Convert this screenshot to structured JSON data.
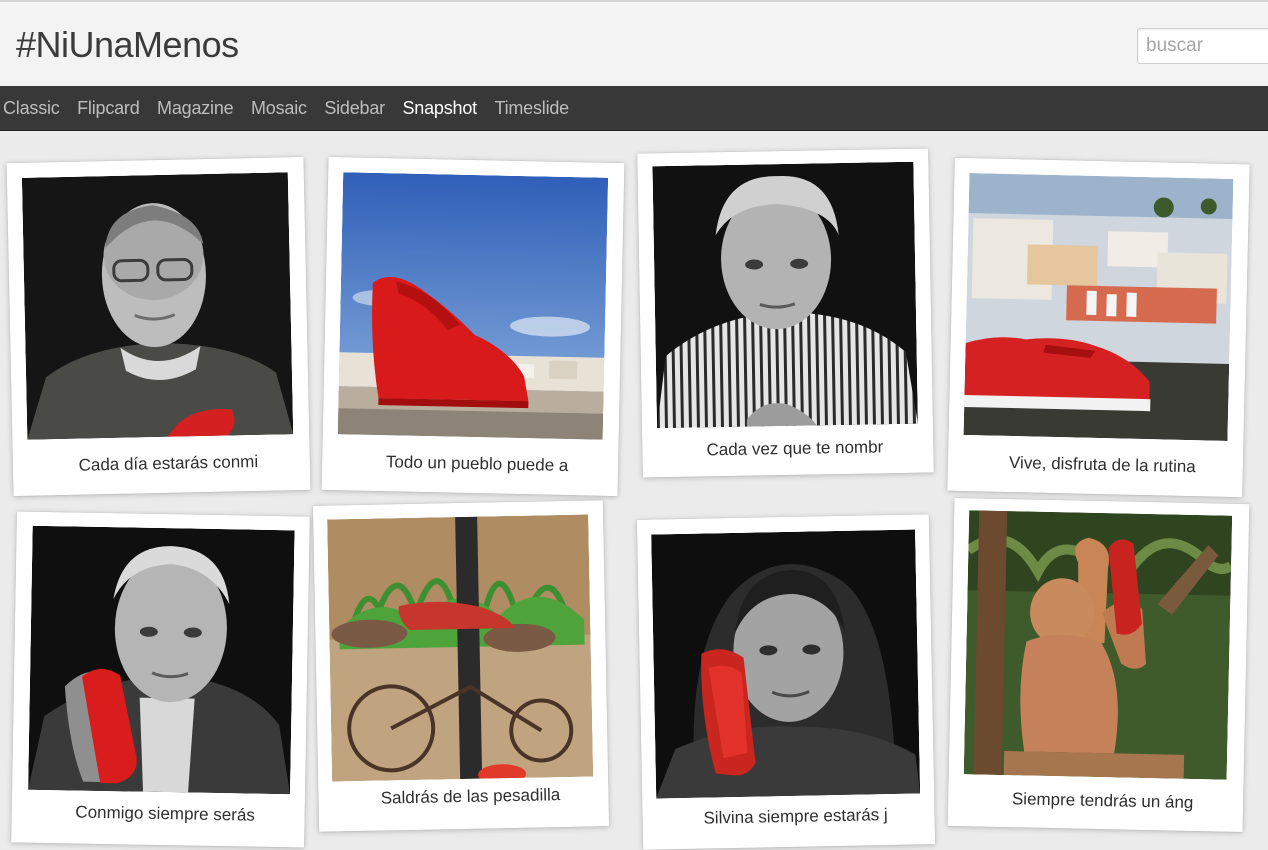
{
  "blog": {
    "title": "#NiUnaMenos"
  },
  "search": {
    "placeholder": "buscar"
  },
  "nav": {
    "items": [
      "Classic",
      "Flipcard",
      "Magazine",
      "Mosaic",
      "Sidebar",
      "Snapshot",
      "Timeslide"
    ],
    "active": "Snapshot"
  },
  "posts": [
    {
      "caption": "Cada día estarás conmi"
    },
    {
      "caption": "Todo un pueblo puede a"
    },
    {
      "caption": "Cada vez que te nombr"
    },
    {
      "caption": "Vive, disfruta de la rutina"
    },
    {
      "caption": "Conmigo siempre serás"
    },
    {
      "caption": "Saldrás de las pesadilla"
    },
    {
      "caption": "Silvina siempre estarás j"
    },
    {
      "caption": "Siempre tendrás un áng"
    }
  ]
}
